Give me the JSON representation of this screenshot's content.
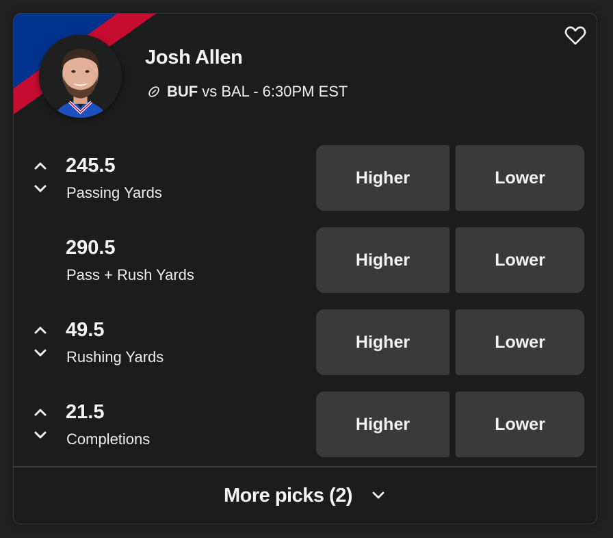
{
  "colors": {
    "team_primary": "#00338d",
    "team_secondary": "#c60c30",
    "card_bg": "#1c1c1c",
    "button_bg": "#3a3a3a"
  },
  "player": {
    "name": "Josh Allen",
    "avatar_alt": "Josh Allen headshot",
    "team": "BUF",
    "matchup_rest": "vs BAL - 6:30PM EST",
    "sport_icon": "football-icon"
  },
  "favorite_icon": "heart-outline-icon",
  "picks": [
    {
      "line": "245.5",
      "stat": "Passing Yards",
      "has_arrows": true,
      "higher_label": "Higher",
      "lower_label": "Lower"
    },
    {
      "line": "290.5",
      "stat": "Pass + Rush Yards",
      "has_arrows": false,
      "higher_label": "Higher",
      "lower_label": "Lower"
    },
    {
      "line": "49.5",
      "stat": "Rushing Yards",
      "has_arrows": true,
      "higher_label": "Higher",
      "lower_label": "Lower"
    },
    {
      "line": "21.5",
      "stat": "Completions",
      "has_arrows": true,
      "higher_label": "Higher",
      "lower_label": "Lower"
    }
  ],
  "more_picks": {
    "label": "More picks (2)",
    "icon": "chevron-down-icon"
  }
}
